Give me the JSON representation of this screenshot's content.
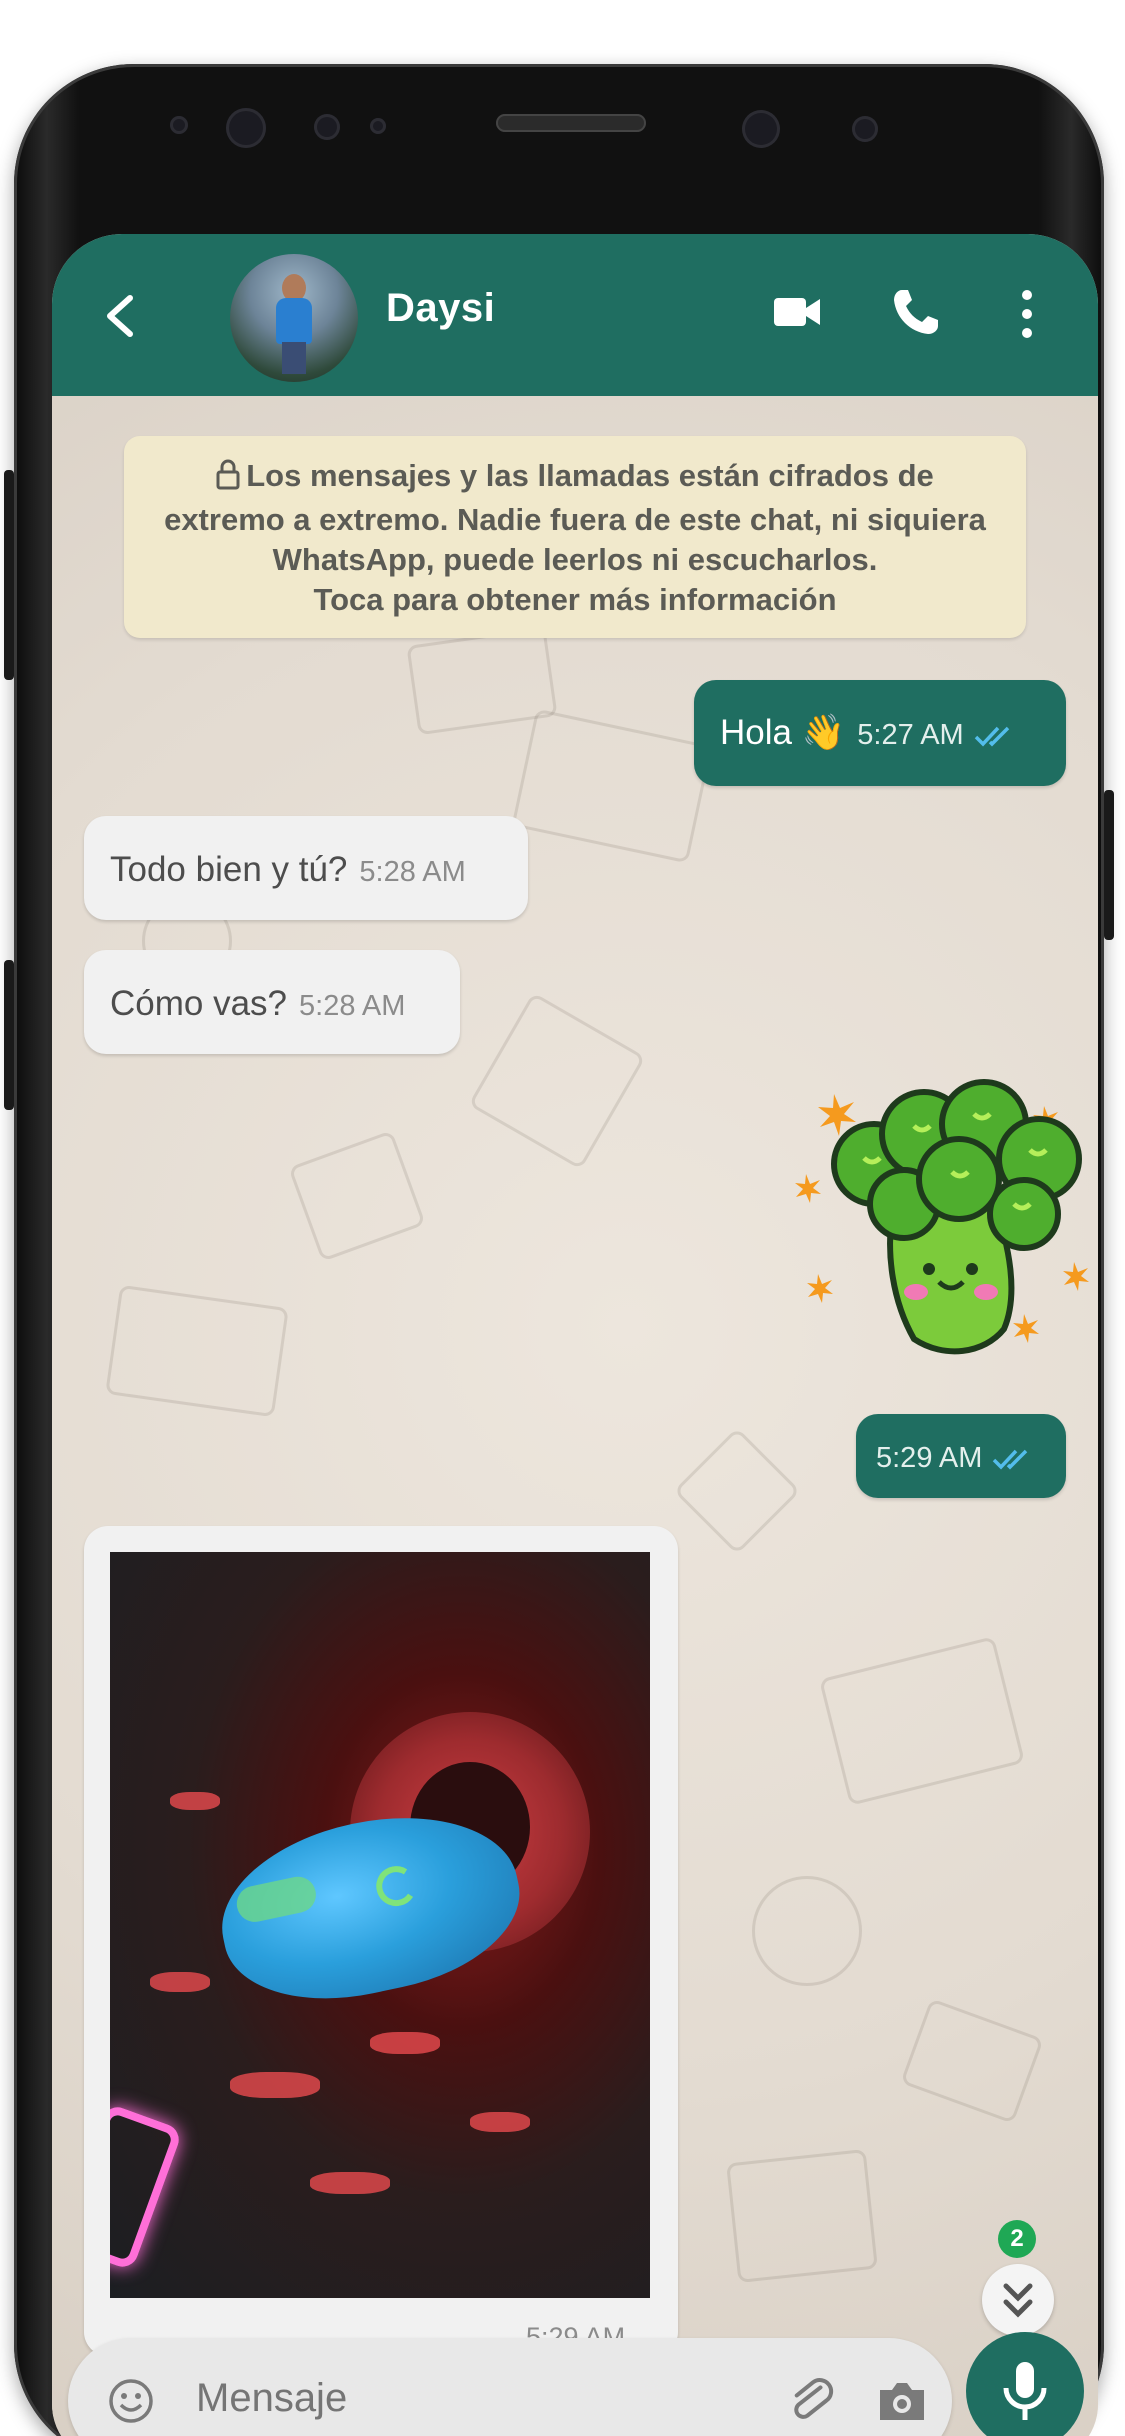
{
  "header": {
    "contact_name": "Daysi"
  },
  "encryption_notice": {
    "line1": "Los mensajes y las llamadas están cifrados de",
    "line2": "extremo a extremo. Nadie fuera de este chat, ni siquiera",
    "line3": "WhatsApp, puede leerlos ni escucharlos.",
    "line4": "Toca para obtener más información"
  },
  "messages": [
    {
      "direction": "outgoing",
      "text": "Hola 👋",
      "time": "5:27 AM",
      "status": "read"
    },
    {
      "direction": "incoming",
      "text": "Todo bien y tú?",
      "time": "5:28 AM"
    },
    {
      "direction": "incoming",
      "text": "Cómo vas?",
      "time": "5:28 AM"
    },
    {
      "direction": "outgoing",
      "type": "sticker",
      "sticker": "broccoli",
      "time": "5:29 AM",
      "status": "read"
    },
    {
      "direction": "incoming",
      "type": "image",
      "time": "5:29 AM"
    }
  ],
  "unread_badge": "2",
  "composer": {
    "placeholder": "Mensaje"
  },
  "colors": {
    "header": "#1f6e61",
    "outgoing_bubble": "#1f6e61",
    "incoming_bubble": "#f1f1f1",
    "notice_bg": "#f1e9cc",
    "read_ticks": "#53bdeb",
    "badge": "#1fa855"
  },
  "icons": [
    "back-arrow-icon",
    "video-call-icon",
    "phone-call-icon",
    "more-vert-icon",
    "lock-icon",
    "read-ticks-icon",
    "double-chevron-down-icon",
    "emoji-icon",
    "attach-icon",
    "camera-icon",
    "mic-icon"
  ]
}
